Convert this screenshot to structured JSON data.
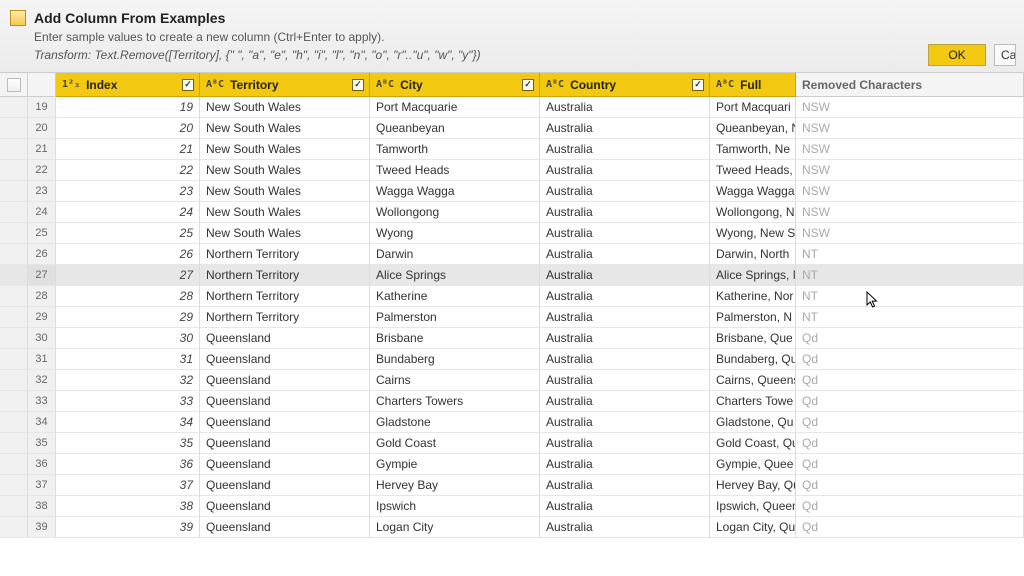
{
  "panel": {
    "title": "Add Column From Examples",
    "subtitle": "Enter sample values to create a new column (Ctrl+Enter to apply).",
    "formula": "Transform: Text.Remove([Territory], {\" \", \"a\", \"e\", \"h\", \"i\", \"l\", \"n\", \"o\", \"r\"..\"u\", \"w\", \"y\"})",
    "ok": "OK",
    "cancel": "Cancel"
  },
  "columns": {
    "index": {
      "label": "Index",
      "type": "1²₃"
    },
    "territory": {
      "label": "Territory",
      "type": "AᴮC"
    },
    "city": {
      "label": "City",
      "type": "AᴮC"
    },
    "country": {
      "label": "Country",
      "type": "AᴮC"
    },
    "full": {
      "label": "Full",
      "type": "AᴮC"
    },
    "removed": {
      "label": "Removed Characters"
    }
  },
  "rows": [
    {
      "n": 19,
      "index": 19,
      "territory": "New South Wales",
      "city": "Port Macquarie",
      "country": "Australia",
      "full": "Port Macquari",
      "removed": "NSW"
    },
    {
      "n": 20,
      "index": 20,
      "territory": "New South Wales",
      "city": "Queanbeyan",
      "country": "Australia",
      "full": "Queanbeyan, N",
      "removed": "NSW"
    },
    {
      "n": 21,
      "index": 21,
      "territory": "New South Wales",
      "city": "Tamworth",
      "country": "Australia",
      "full": "Tamworth, Ne",
      "removed": "NSW"
    },
    {
      "n": 22,
      "index": 22,
      "territory": "New South Wales",
      "city": "Tweed Heads",
      "country": "Australia",
      "full": "Tweed Heads,",
      "removed": "NSW"
    },
    {
      "n": 23,
      "index": 23,
      "territory": "New South Wales",
      "city": "Wagga Wagga",
      "country": "Australia",
      "full": "Wagga Wagga,",
      "removed": "NSW"
    },
    {
      "n": 24,
      "index": 24,
      "territory": "New South Wales",
      "city": "Wollongong",
      "country": "Australia",
      "full": "Wollongong, N",
      "removed": "NSW"
    },
    {
      "n": 25,
      "index": 25,
      "territory": "New South Wales",
      "city": "Wyong",
      "country": "Australia",
      "full": "Wyong, New S",
      "removed": "NSW"
    },
    {
      "n": 26,
      "index": 26,
      "territory": "Northern Territory",
      "city": "Darwin",
      "country": "Australia",
      "full": "Darwin, North",
      "removed": "NT"
    },
    {
      "n": 27,
      "index": 27,
      "territory": "Northern Territory",
      "city": "Alice Springs",
      "country": "Australia",
      "full": "Alice Springs, N",
      "removed": "NT",
      "selected": true
    },
    {
      "n": 28,
      "index": 28,
      "territory": "Northern Territory",
      "city": "Katherine",
      "country": "Australia",
      "full": "Katherine, Nor",
      "removed": "NT"
    },
    {
      "n": 29,
      "index": 29,
      "territory": "Northern Territory",
      "city": "Palmerston",
      "country": "Australia",
      "full": "Palmerston, N",
      "removed": "NT"
    },
    {
      "n": 30,
      "index": 30,
      "territory": "Queensland",
      "city": "Brisbane",
      "country": "Australia",
      "full": "Brisbane, Que",
      "removed": "Qd"
    },
    {
      "n": 31,
      "index": 31,
      "territory": "Queensland",
      "city": "Bundaberg",
      "country": "Australia",
      "full": "Bundaberg, Qu",
      "removed": "Qd"
    },
    {
      "n": 32,
      "index": 32,
      "territory": "Queensland",
      "city": "Cairns",
      "country": "Australia",
      "full": "Cairns, Queens",
      "removed": "Qd"
    },
    {
      "n": 33,
      "index": 33,
      "territory": "Queensland",
      "city": "Charters Towers",
      "country": "Australia",
      "full": "Charters Towe",
      "removed": "Qd"
    },
    {
      "n": 34,
      "index": 34,
      "territory": "Queensland",
      "city": "Gladstone",
      "country": "Australia",
      "full": "Gladstone, Qu",
      "removed": "Qd"
    },
    {
      "n": 35,
      "index": 35,
      "territory": "Queensland",
      "city": "Gold Coast",
      "country": "Australia",
      "full": "Gold Coast, Qu",
      "removed": "Qd"
    },
    {
      "n": 36,
      "index": 36,
      "territory": "Queensland",
      "city": "Gympie",
      "country": "Australia",
      "full": "Gympie, Quee",
      "removed": "Qd"
    },
    {
      "n": 37,
      "index": 37,
      "territory": "Queensland",
      "city": "Hervey Bay",
      "country": "Australia",
      "full": "Hervey Bay, Qu",
      "removed": "Qd"
    },
    {
      "n": 38,
      "index": 38,
      "territory": "Queensland",
      "city": "Ipswich",
      "country": "Australia",
      "full": "Ipswich, Queen",
      "removed": "Qd"
    },
    {
      "n": 39,
      "index": 39,
      "territory": "Queensland",
      "city": "Logan City",
      "country": "Australia",
      "full": "Logan City, Qu",
      "removed": "Qd"
    }
  ]
}
